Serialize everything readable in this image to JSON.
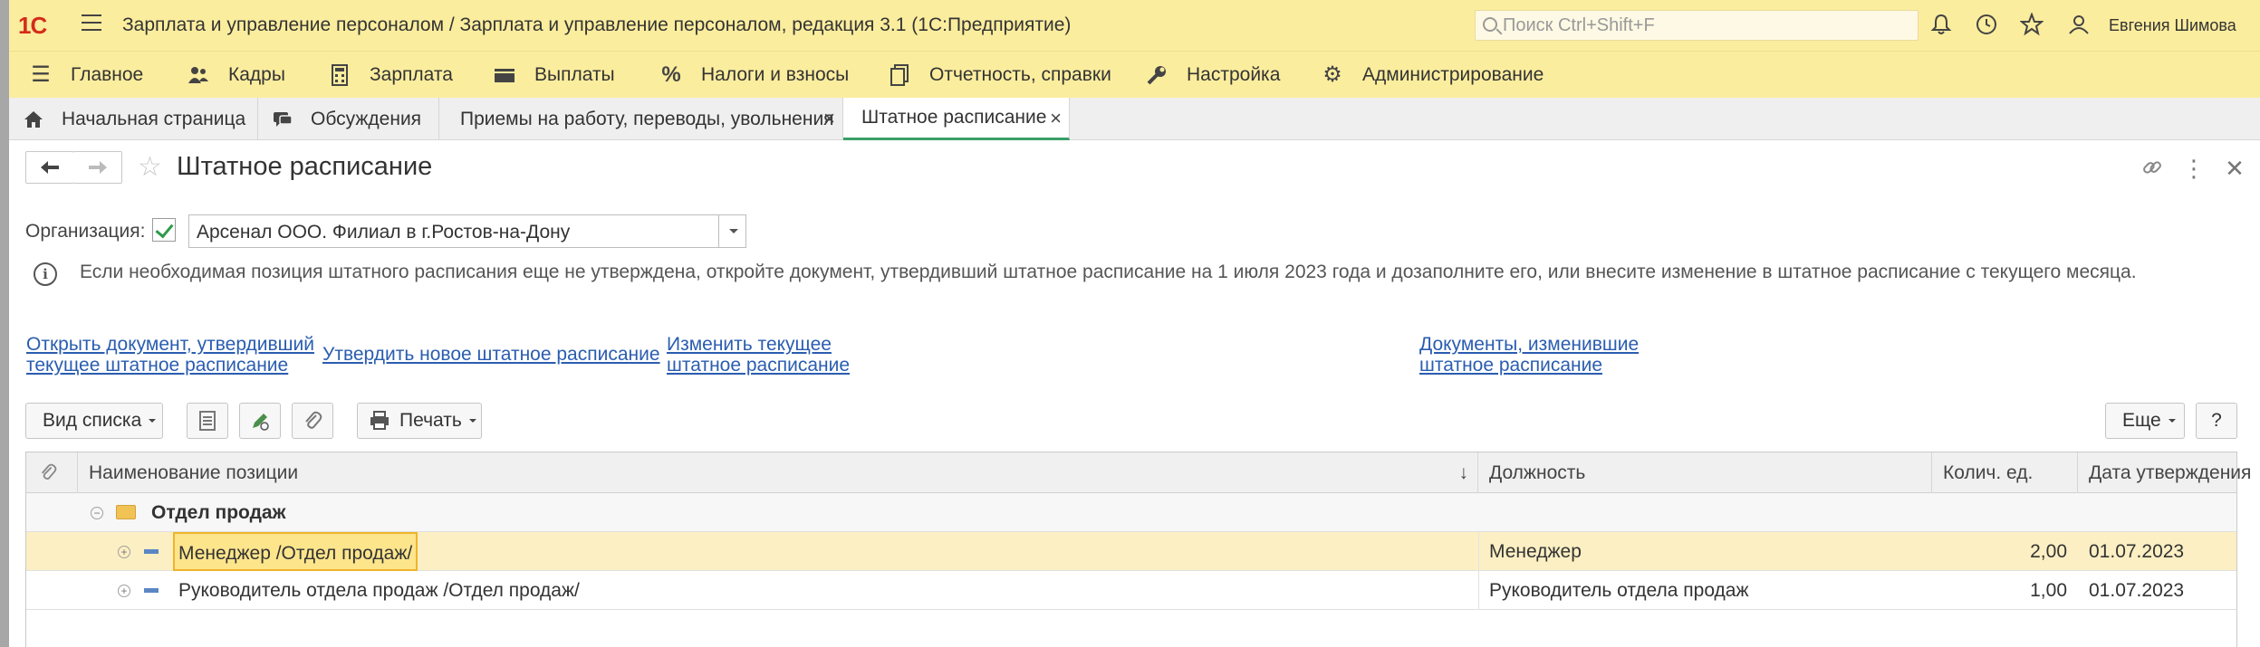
{
  "window": {
    "logo": "1С",
    "title": "Зарплата и управление персоналом / Зарплата и управление персоналом, редакция 3.1  (1С:Предприятие)",
    "search_placeholder": "Поиск Ctrl+Shift+F",
    "user": "Евгения Шимова",
    "icons": [
      "bell-icon",
      "history-icon",
      "star-icon",
      "user-icon"
    ]
  },
  "menu": [
    {
      "label": "Главное",
      "icon": "menu-icon"
    },
    {
      "label": "Кадры",
      "icon": "people-icon"
    },
    {
      "label": "Зарплата",
      "icon": "calculator-icon"
    },
    {
      "label": "Выплаты",
      "icon": "wallet-icon"
    },
    {
      "label": "Налоги и взносы",
      "icon": "percent-icon"
    },
    {
      "label": "Отчетность, справки",
      "icon": "documents-icon"
    },
    {
      "label": "Настройка",
      "icon": "wrench-icon"
    },
    {
      "label": "Администрирование",
      "icon": "gear-icon"
    }
  ],
  "tabs": [
    {
      "label": "Начальная страница",
      "icon": "home-icon"
    },
    {
      "label": "Обсуждения",
      "icon": "chat-icon"
    },
    {
      "label": "Приемы на работу, переводы, увольнения",
      "close": "×"
    },
    {
      "label": "Штатное расписание",
      "close": "×",
      "active": true
    }
  ],
  "form": {
    "title": "Штатное расписание",
    "org_label": "Организация:",
    "org_checked": true,
    "org_value": "Арсенал ООО. Филиал в г.Ростов-на-Дону",
    "info": "Если необходимая позиция штатного расписания еще не утверждена, откройте документ, утвердивший штатное расписание на 1 июля 2023 года и дозаполните его, или внесите изменение в штатное расписание с текущего месяца."
  },
  "links": {
    "open_doc_1": "Открыть документ, утвердивший",
    "open_doc_2": "текущее штатное расписание",
    "approve_new": "Утвердить новое штатное расписание",
    "change_1": "Изменить текущее",
    "change_2": "штатное расписание",
    "docs_1": "Документы, изменившие",
    "docs_2": "штатное расписание"
  },
  "toolbar": {
    "view_list": "Вид списка",
    "print": "Печать",
    "more": "Еще",
    "help": "?"
  },
  "table": {
    "columns": {
      "name": "Наименование позиции",
      "sort": "↓",
      "position": "Должность",
      "count": "Колич. ед.",
      "date": "Дата утверждения"
    },
    "group": "Отдел продаж",
    "rows": [
      {
        "name": "Менеджер /Отдел продаж/",
        "position": "Менеджер",
        "count": "2,00",
        "date": "01.07.2023",
        "selected": true
      },
      {
        "name": "Руководитель отдела продаж /Отдел продаж/",
        "position": "Руководитель отдела продаж",
        "count": "1,00",
        "date": "01.07.2023"
      }
    ]
  },
  "colors": {
    "header_bg": "#fbed9e",
    "accent_green": "#3b9f69",
    "link": "#2a5db0",
    "selection": "#fde58c"
  }
}
